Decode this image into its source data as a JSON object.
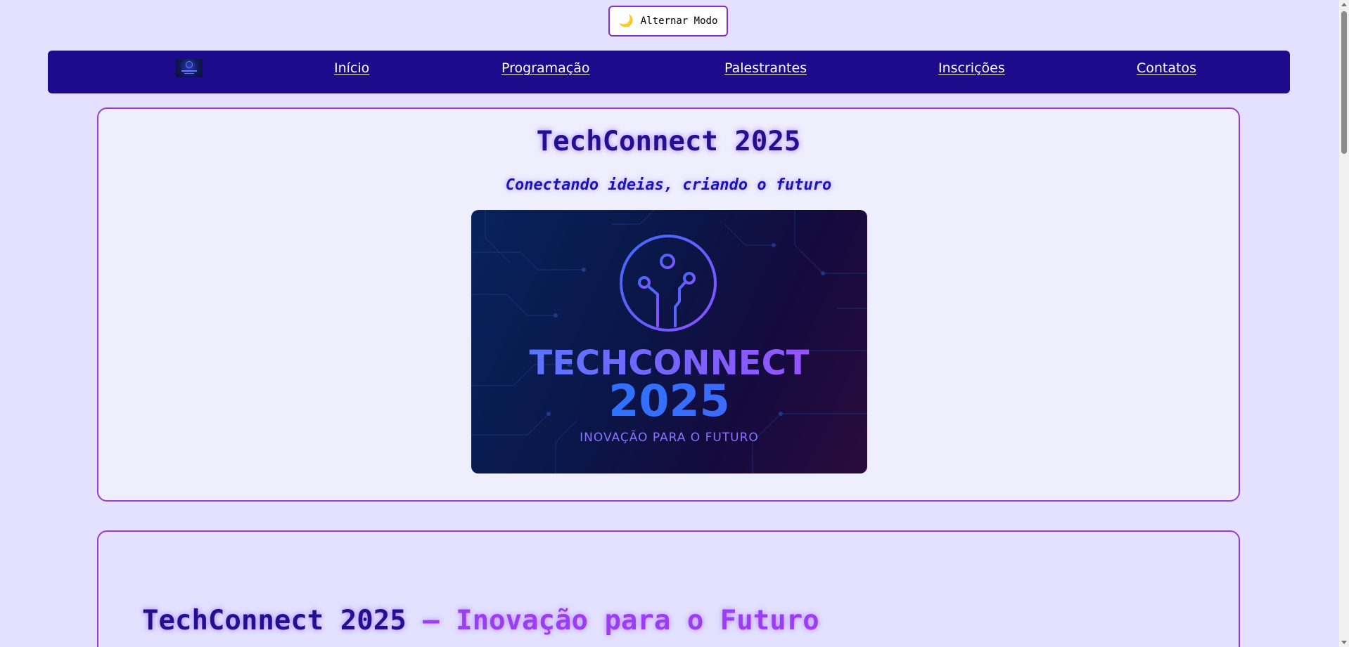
{
  "toggle": {
    "icon": "moon-icon",
    "glyph": "🌙",
    "label": "Alternar Modo"
  },
  "nav": {
    "logo": "techconnect-logo",
    "items": [
      {
        "label": "Início"
      },
      {
        "label": "Programação"
      },
      {
        "label": "Palestrantes"
      },
      {
        "label": "Inscrições"
      },
      {
        "label": "Contatos"
      }
    ]
  },
  "hero": {
    "title": "TechConnect 2025",
    "subtitle": "Conectando ideias, criando o futuro",
    "banner": {
      "title": "TECHCONNECT",
      "year": "2025",
      "tagline": "INOVAÇÃO PARA O FUTURO"
    }
  },
  "section2": {
    "title_part1": "TechConnect 2025 ",
    "title_part2": "– Inovação para o Futuro"
  },
  "colors": {
    "page_bg": "#e3e1ff",
    "nav_bg": "#1e0b8c",
    "card_border": "#9a3cd8",
    "title": "#24108f",
    "accent": "#9b3df2"
  }
}
